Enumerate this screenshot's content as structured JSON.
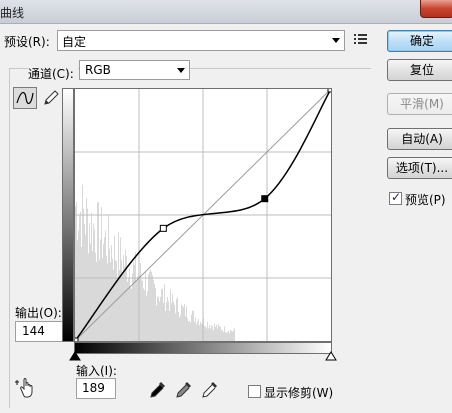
{
  "window": {
    "title": "曲线"
  },
  "preset": {
    "label": "预设(R):",
    "value": "自定"
  },
  "channel": {
    "label": "通道(C):",
    "value": "RGB"
  },
  "output": {
    "label": "输出(O):",
    "value": "144"
  },
  "input": {
    "label": "输入(I):",
    "value": "189"
  },
  "show_clipping": {
    "label": "显示修剪(W)",
    "checked": false
  },
  "buttons": {
    "ok": "确定",
    "reset": "复位",
    "smooth": "平滑(M)",
    "auto": "自动(A)",
    "options": "选项(T)..."
  },
  "preview": {
    "label": "预览(P)",
    "checked": true,
    "check_glyph": "✓"
  },
  "icons": {
    "preset_menu": "list-menu-icon",
    "curve_tool": "curve-tool-icon",
    "pencil_tool": "pencil-icon",
    "hand_tool": "hand-adjust-icon",
    "eyedropper_black": "eyedropper-black-icon",
    "eyedropper_gray": "eyedropper-gray-icon",
    "eyedropper_white": "eyedropper-white-icon"
  },
  "colors": {
    "ok_button": "#a6d3f2",
    "histogram": "#d9d9d9",
    "curve": "#000000",
    "grid": "#bdbdbd"
  },
  "curve": {
    "grid_divisions": 4,
    "points": [
      {
        "input": 0,
        "output": 0
      },
      {
        "input": 88,
        "output": 114
      },
      {
        "input": 189,
        "output": 144
      },
      {
        "input": 255,
        "output": 255
      }
    ],
    "selected_point_input": 189
  }
}
